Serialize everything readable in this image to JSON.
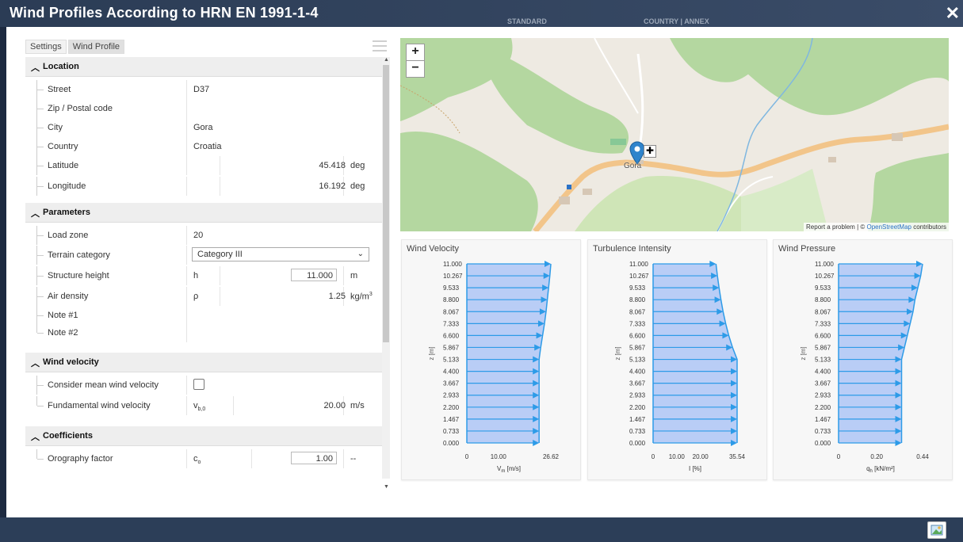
{
  "window": {
    "title": "Wind Profiles According to HRN EN 1991-1-4",
    "ghost_left": "STANDARD",
    "ghost_right": "COUNTRY | ANNEX",
    "close_label": "✕"
  },
  "tabs": [
    {
      "label": "Settings"
    },
    {
      "label": "Wind Profile"
    }
  ],
  "location": {
    "header": "Location",
    "rows": [
      {
        "name": "Street",
        "value": "D37"
      },
      {
        "name": "Zip / Postal code",
        "value": ""
      },
      {
        "name": "City",
        "value": "Gora"
      },
      {
        "name": "Country",
        "value": "Croatia"
      },
      {
        "name": "Latitude",
        "value": "45.418",
        "unit": "deg"
      },
      {
        "name": "Longitude",
        "value": "16.192",
        "unit": "deg"
      }
    ]
  },
  "parameters": {
    "header": "Parameters",
    "load_zone": {
      "name": "Load zone",
      "value": "20"
    },
    "terrain": {
      "name": "Terrain category",
      "value": "Category III"
    },
    "height": {
      "name": "Structure height",
      "symbol": "h",
      "value": "11.000",
      "unit": "m"
    },
    "air": {
      "name": "Air density",
      "symbol": "ρ",
      "value": "1.25",
      "unit": "kg/m",
      "unit_sup": "3"
    },
    "note1": {
      "name": "Note #1"
    },
    "note2": {
      "name": "Note #2"
    }
  },
  "velocity": {
    "header": "Wind velocity",
    "mean": {
      "name": "Consider mean wind velocity",
      "checked": false
    },
    "fundamental": {
      "name": "Fundamental wind velocity",
      "symbol": "v",
      "symbol_sub": "b,0",
      "value": "20.00",
      "unit": "m/s"
    }
  },
  "coefficients": {
    "header": "Coefficients",
    "orography": {
      "name": "Orography factor",
      "symbol": "c",
      "symbol_sub": "o",
      "value": "1.00",
      "unit": "--"
    }
  },
  "map": {
    "zoom_in": "+",
    "zoom_out": "−",
    "place_label": "Gora",
    "attribution_prefix": "Report a problem | © ",
    "attribution_link": "OpenStreetMap",
    "attribution_suffix": " contributors"
  },
  "chart_data": [
    {
      "type": "area",
      "title": "Wind Velocity",
      "ylabel": "z [m]",
      "xlabel": "V",
      "xlabel_sub": "m",
      "xlabel_unit": " [m/s]",
      "xticks": [
        "0",
        "10.00",
        "26.62"
      ],
      "xtick_values": [
        0,
        10,
        26.62
      ],
      "xlim": [
        0,
        26.62
      ],
      "y": [
        0.0,
        0.733,
        1.467,
        2.2,
        2.933,
        3.667,
        4.4,
        5.133,
        5.867,
        6.6,
        7.333,
        8.067,
        8.8,
        9.533,
        10.267,
        11.0
      ],
      "ytick_labels": [
        "0.000",
        "0.733",
        "1.467",
        "2.200",
        "2.933",
        "3.667",
        "4.400",
        "5.133",
        "5.867",
        "6.600",
        "7.333",
        "8.067",
        "8.800",
        "9.533",
        "10.267",
        "11.000"
      ],
      "x": [
        22.9,
        22.9,
        22.9,
        22.9,
        22.9,
        22.9,
        22.9,
        22.9,
        23.4,
        24.0,
        24.6,
        25.1,
        25.5,
        25.9,
        26.3,
        26.62
      ]
    },
    {
      "type": "area",
      "title": "Turbulence Intensity",
      "ylabel": "z [m]",
      "xlabel": "I",
      "xlabel_sub": "",
      "xlabel_unit": " [%]",
      "xticks": [
        "0",
        "10.00",
        "20.00",
        "35.54"
      ],
      "xtick_values": [
        0,
        10,
        20,
        35.54
      ],
      "xlim": [
        0,
        35.54
      ],
      "y": [
        0.0,
        0.733,
        1.467,
        2.2,
        2.933,
        3.667,
        4.4,
        5.133,
        5.867,
        6.6,
        7.333,
        8.067,
        8.8,
        9.533,
        10.267,
        11.0
      ],
      "ytick_labels": [
        "0.000",
        "0.733",
        "1.467",
        "2.200",
        "2.933",
        "3.667",
        "4.400",
        "5.133",
        "5.867",
        "6.600",
        "7.333",
        "8.067",
        "8.800",
        "9.533",
        "10.267",
        "11.000"
      ],
      "x": [
        35.54,
        35.54,
        35.54,
        35.54,
        35.54,
        35.54,
        35.54,
        35.54,
        33.6,
        32.0,
        30.7,
        29.6,
        28.7,
        27.9,
        27.2,
        26.6
      ]
    },
    {
      "type": "area",
      "title": "Wind Pressure",
      "ylabel": "z [m]",
      "xlabel": "q",
      "xlabel_sub": "h",
      "xlabel_unit": " [kN/m²]",
      "xticks": [
        "0",
        "0.20",
        "0.44"
      ],
      "xtick_values": [
        0,
        0.2,
        0.44
      ],
      "xlim": [
        0,
        0.44
      ],
      "y": [
        0.0,
        0.733,
        1.467,
        2.2,
        2.933,
        3.667,
        4.4,
        5.133,
        5.867,
        6.6,
        7.333,
        8.067,
        8.8,
        9.533,
        10.267,
        11.0
      ],
      "ytick_labels": [
        "0.000",
        "0.733",
        "1.467",
        "2.200",
        "2.933",
        "3.667",
        "4.400",
        "5.133",
        "5.867",
        "6.600",
        "7.333",
        "8.067",
        "8.800",
        "9.533",
        "10.267",
        "11.000"
      ],
      "x": [
        0.33,
        0.33,
        0.33,
        0.33,
        0.33,
        0.33,
        0.33,
        0.33,
        0.345,
        0.36,
        0.375,
        0.39,
        0.4,
        0.415,
        0.43,
        0.44
      ]
    }
  ]
}
